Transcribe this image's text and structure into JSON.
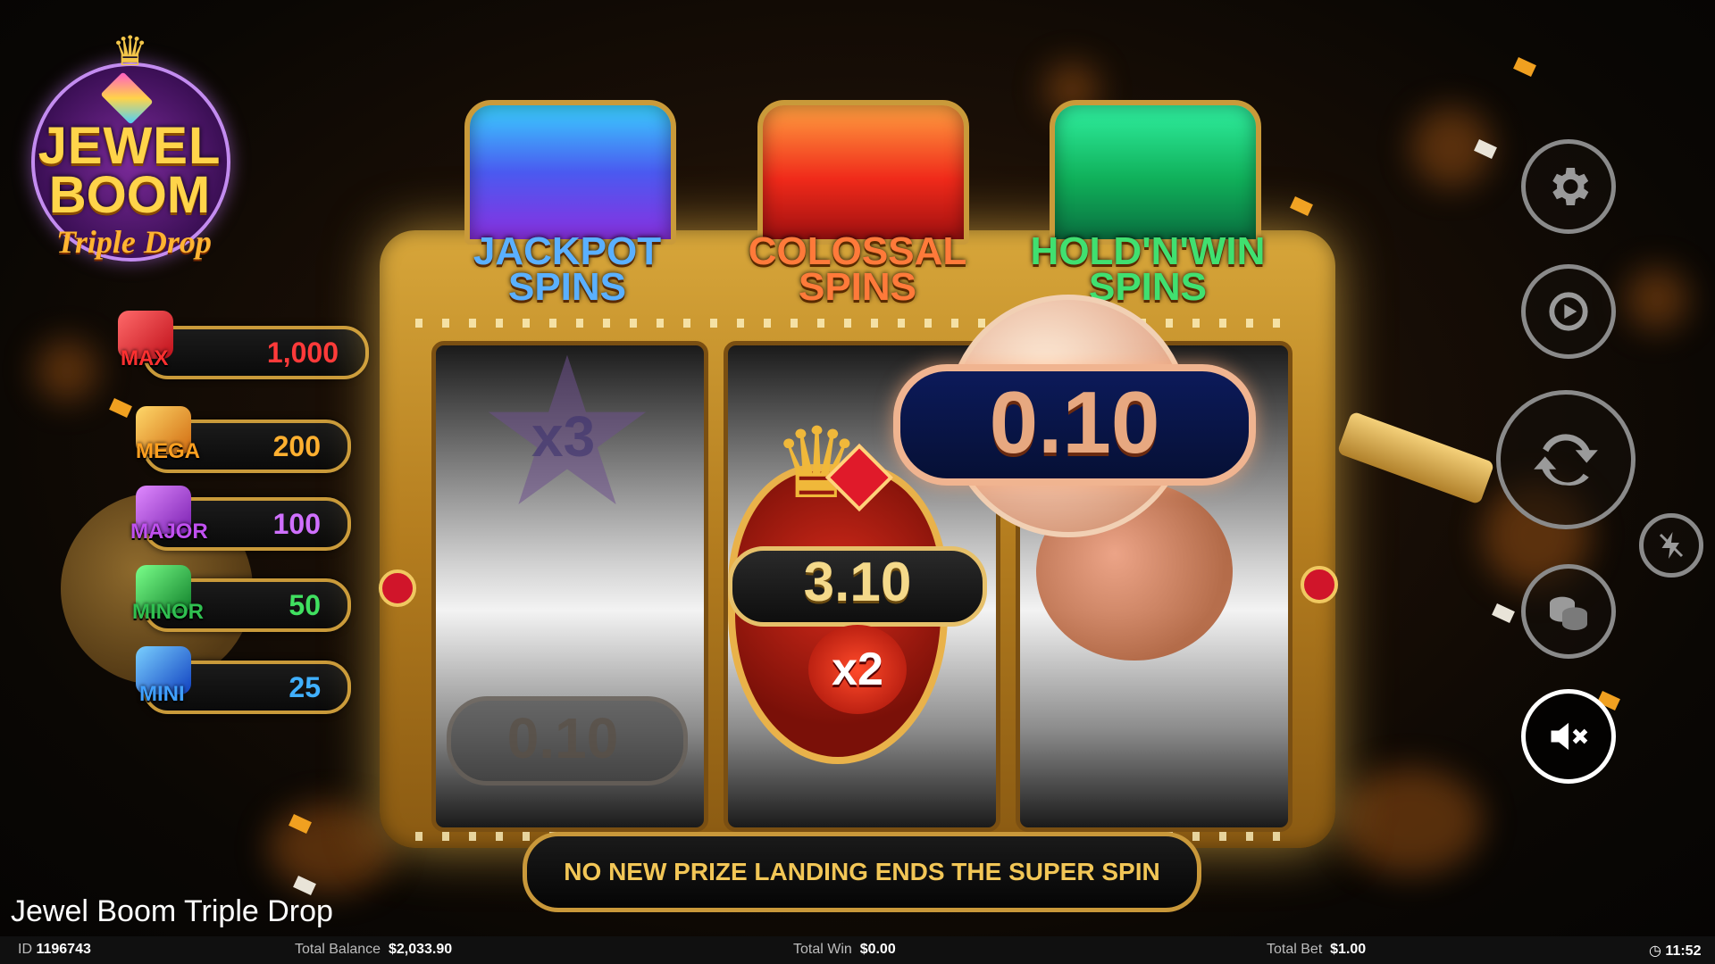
{
  "logo": {
    "line1": "JEWEL",
    "line2": "BOOM",
    "line3": "Triple Drop"
  },
  "jackpots": [
    {
      "name": "MAX",
      "value": "1,000",
      "color": "#e0202a"
    },
    {
      "name": "MEGA",
      "value": "200",
      "color": "#f0a020"
    },
    {
      "name": "MAJOR",
      "value": "100",
      "color": "#b04ad8"
    },
    {
      "name": "MINOR",
      "value": "50",
      "color": "#2ab04a"
    },
    {
      "name": "MINI",
      "value": "25",
      "color": "#2a7ae0"
    }
  ],
  "chests": [
    {
      "label": "JACKPOT SPINS",
      "color": "#4a7af0"
    },
    {
      "label": "COLOSSAL SPINS",
      "color": "#e8402a"
    },
    {
      "label": "HOLD'N'WIN SPINS",
      "color": "#1fae5a"
    }
  ],
  "reels": {
    "left_symbol_multiplier": "x3",
    "left_ghost_value": "0.10",
    "center_value": "3.10",
    "center_multiplier": "x2",
    "right_prize_value": "0.10"
  },
  "banner": "NO NEW PRIZE LANDING ENDS THE SUPER SPIN",
  "controls": [
    "gear-icon",
    "autoplay-icon",
    "spin-icon",
    "turbo-icon",
    "coins-icon",
    "mute-icon"
  ],
  "game_title": "Jewel Boom Triple Drop",
  "status": {
    "id_label": "ID",
    "id_value": "1196743",
    "balance_label": "Total Balance",
    "balance_value": "$2,033.90",
    "win_label": "Total Win",
    "win_value": "$0.00",
    "bet_label": "Total Bet",
    "bet_value": "$1.00",
    "clock": "11:52"
  }
}
